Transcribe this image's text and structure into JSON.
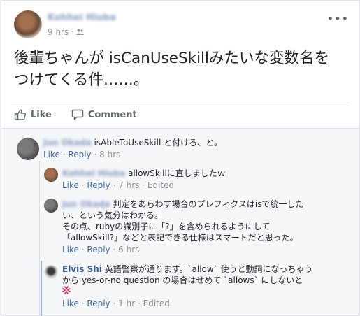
{
  "post": {
    "author": "Kohhei Hiuba",
    "time": "9 hrs",
    "privacy_icon": "friends-icon",
    "menu_icon": "more-horizontal-icon",
    "text_line1": "後輩ちゃんが isCanUseSkillみたいな変数名を",
    "text_line2": "つけてくる件……。"
  },
  "actions": {
    "like_label": "Like",
    "comment_label": "Comment"
  },
  "comments": [
    {
      "author": "Jun Okada",
      "text": "isAbleToUseSkill と付けろ、と。",
      "like": "Like",
      "reply": "Reply",
      "time": "8 hrs"
    },
    {
      "author": "Kohhei Hiuba",
      "text": "allowSkillに直しましたｗ",
      "like": "Like",
      "reply": "Reply",
      "time": "7 hrs",
      "edited": "Edited"
    },
    {
      "author": "Jun Okada",
      "text_line1": "判定をあらわす場合のプレフィクスはisで統一した",
      "text_line2": "い、という気分はわかる。",
      "text_line3": "その点、rubyの識別子に「?」を含められるようにして",
      "text_line4": "「allowSkill?」などと表記できる仕様はスマートだと思った。",
      "like": "Like",
      "reply": "Reply",
      "time": "6 hrs"
    },
    {
      "author": "Elvis Shi",
      "text_line1": "英語警察が通ります。`allow` 使うと動詞になっちゃう",
      "text_line2": "から yes-or-no question の場合はせめて `allows` にしないと",
      "emoji": "angry-icon",
      "like": "Like",
      "reply": "Reply",
      "time": "1 hr",
      "edited": "Edited"
    }
  ],
  "dot": "·"
}
